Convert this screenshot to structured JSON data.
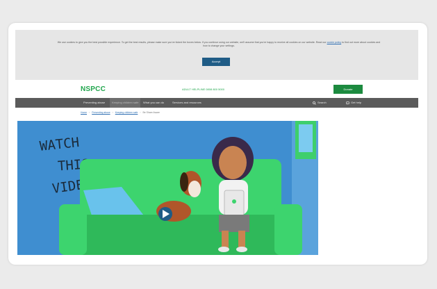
{
  "cookie_banner": {
    "text": "We use cookies to give you the best possible experience. To get the best results, please make sure you've ticked the boxes below. If you continue using our website, we'll assume that you're happy to receive all cookies on our website. Read our",
    "link_text": "cookie policy",
    "text_after": "to find out more about cookies and how to change your settings.",
    "button_label": "Accept"
  },
  "header": {
    "logo": "NSPCC",
    "helpline": "ADULT HELPLINE 0808 800 5000",
    "donate_label": "Donate"
  },
  "nav": {
    "items": [
      "Preventing abuse",
      "Keeping children safe",
      "What you can do",
      "Services and resources"
    ],
    "active_index": 1,
    "search_label": "Search",
    "help_label": "Get help"
  },
  "breadcrumb": {
    "items": [
      "Home",
      "Preventing abuse",
      "Keeping children safe",
      "Be Share Aware"
    ]
  },
  "video": {
    "overlay_text": [
      "WATCH",
      "THIS",
      "VIDEO"
    ],
    "colors": {
      "background": "#3f8ed0",
      "sofa": "#3dd46e",
      "sofa_dark": "#2fb95a",
      "play_button": "#1f5c86"
    }
  },
  "colors": {
    "brand_green": "#21a64d",
    "donate": "#1c8a3f",
    "nav_bg": "#5b5b5b",
    "cookie_bg": "#e6e6e6",
    "accept_button": "#1f5c86"
  }
}
